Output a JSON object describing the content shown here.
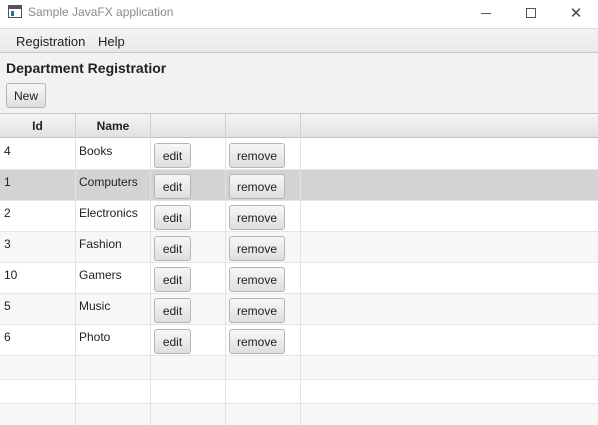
{
  "window": {
    "title": "Sample JavaFX application",
    "minimize_icon": "minimize-icon",
    "maximize_icon": "maximize-icon",
    "close_icon": "close-icon",
    "close_glyph": "✕"
  },
  "menubar": {
    "items": [
      {
        "label": "Registration"
      },
      {
        "label": "Help"
      }
    ]
  },
  "page": {
    "title": "Department Registratior",
    "new_button": "New"
  },
  "table": {
    "columns": [
      {
        "label": "Id"
      },
      {
        "label": "Name"
      },
      {
        "label": ""
      },
      {
        "label": ""
      },
      {
        "label": ""
      }
    ],
    "edit_label": "edit",
    "remove_label": "remove",
    "rows": [
      {
        "id": "4",
        "name": "Books"
      },
      {
        "id": "1",
        "name": "Computers"
      },
      {
        "id": "2",
        "name": "Electronics"
      },
      {
        "id": "3",
        "name": "Fashion"
      },
      {
        "id": "10",
        "name": "Gamers"
      },
      {
        "id": "5",
        "name": "Music"
      },
      {
        "id": "6",
        "name": "Photo"
      }
    ],
    "selected_row_index": 1
  },
  "colors": {
    "selected_row": "#d3d3d3",
    "alt_row": "#f7f7f7"
  }
}
